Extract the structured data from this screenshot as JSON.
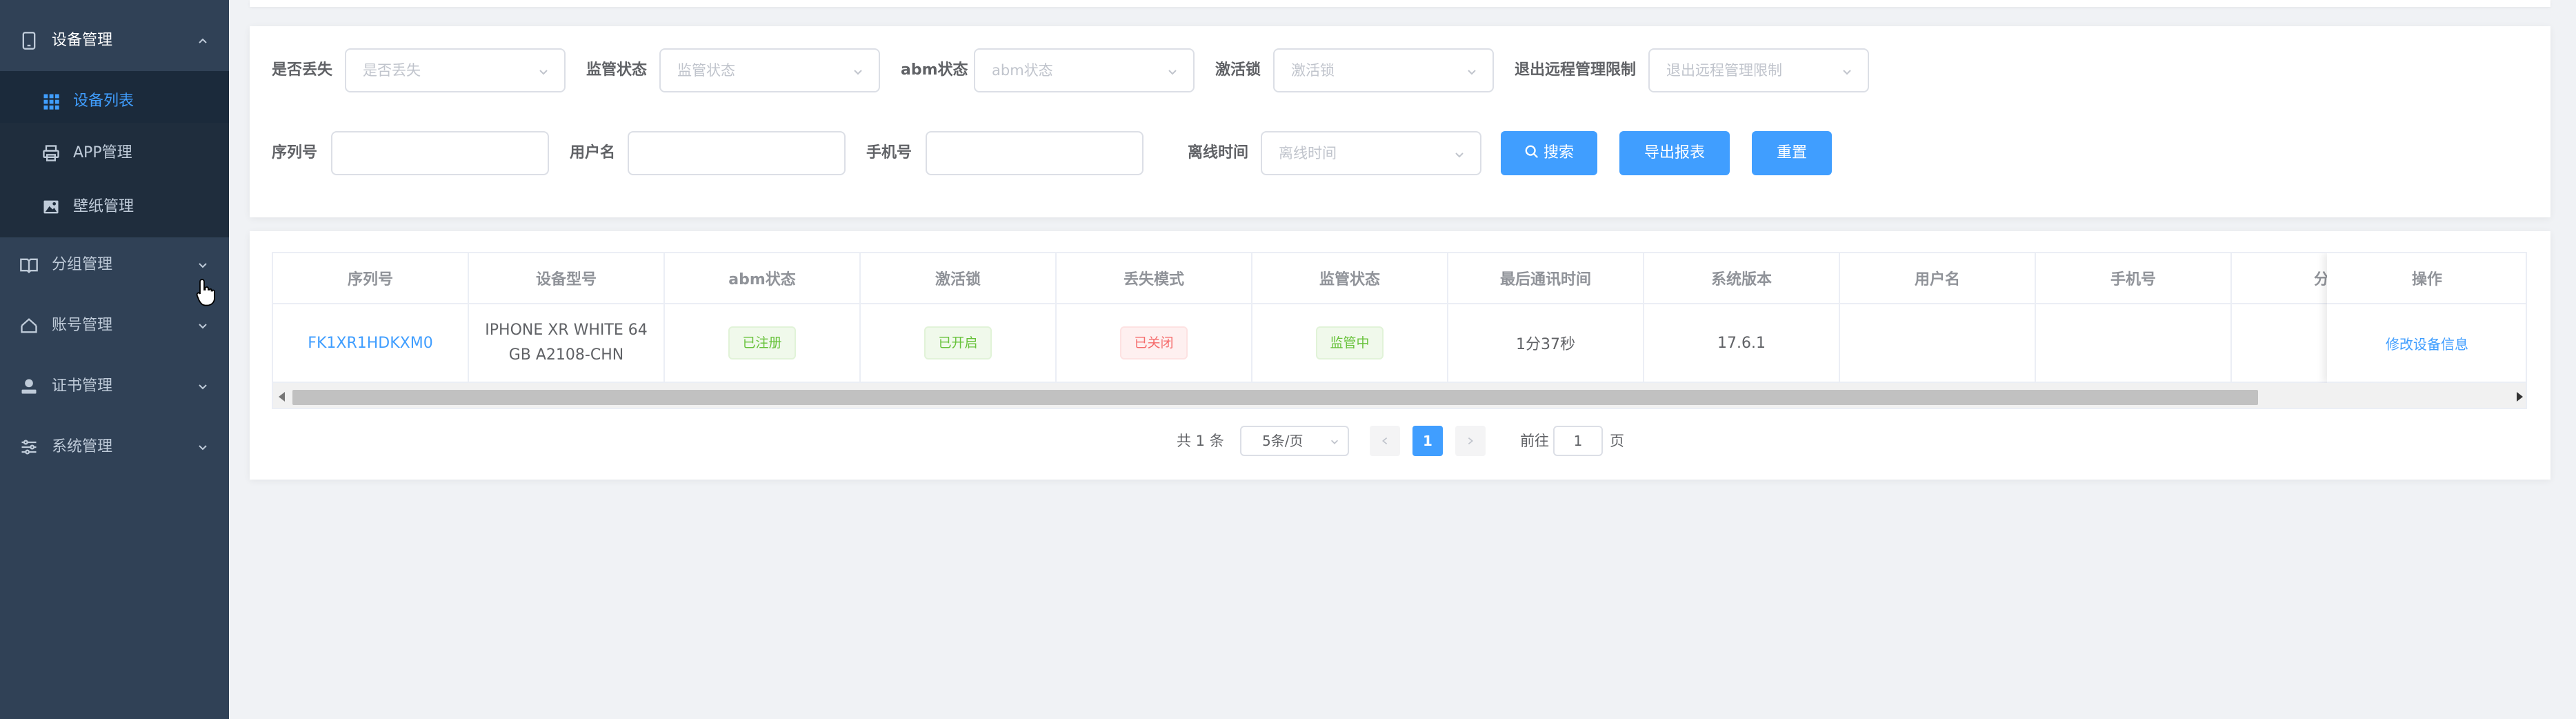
{
  "sidebar": {
    "device_mgmt": "设备管理",
    "device_list": "设备列表",
    "app_mgmt": "APP管理",
    "wallpaper_mgmt": "壁纸管理",
    "group_mgmt": "分组管理",
    "account_mgmt": "账号管理",
    "cert_mgmt": "证书管理",
    "system_mgmt": "系统管理"
  },
  "filters": {
    "lost": {
      "label": "是否丢失",
      "placeholder": "是否丢失"
    },
    "supervise": {
      "label": "监管状态",
      "placeholder": "监管状态"
    },
    "abm": {
      "label": "abm状态",
      "placeholder": "abm状态"
    },
    "activation_lock": {
      "label": "激活锁",
      "placeholder": "激活锁"
    },
    "exit_remote": {
      "label": "退出远程管理限制",
      "placeholder": "退出远程管理限制"
    },
    "serial": {
      "label": "序列号",
      "value": ""
    },
    "username": {
      "label": "用户名",
      "value": ""
    },
    "phone": {
      "label": "手机号",
      "value": ""
    },
    "offline_time": {
      "label": "离线时间",
      "placeholder": "离线时间"
    }
  },
  "buttons": {
    "search": "搜索",
    "export": "导出报表",
    "reset": "重置"
  },
  "table": {
    "columns": [
      "序列号",
      "设备型号",
      "abm状态",
      "激活锁",
      "丢失模式",
      "监管状态",
      "最后通讯时间",
      "系统版本",
      "用户名",
      "手机号",
      "分组"
    ],
    "action_column": "操作",
    "rows": [
      {
        "serial": "FK1XR1HDKXM0",
        "model": "IPHONE XR WHITE 64GB A2108-CHN",
        "abm": "已注册",
        "activation_lock": "已开启",
        "lost_mode": "已关闭",
        "supervise": "监管中",
        "last_comm": "1分37秒",
        "os_version": "17.6.1",
        "username": "",
        "phone": "",
        "group": "",
        "action": "修改设备信息"
      }
    ]
  },
  "pagination": {
    "total": "共 1 条",
    "page_size": "5条/页",
    "current_page": "1",
    "goto_prefix": "前往",
    "goto_value": "1",
    "goto_suffix": "页"
  },
  "colors": {
    "sidebar_bg": "#304156",
    "accent": "#409eff",
    "success": "#67c23a",
    "danger": "#f56c6c"
  }
}
